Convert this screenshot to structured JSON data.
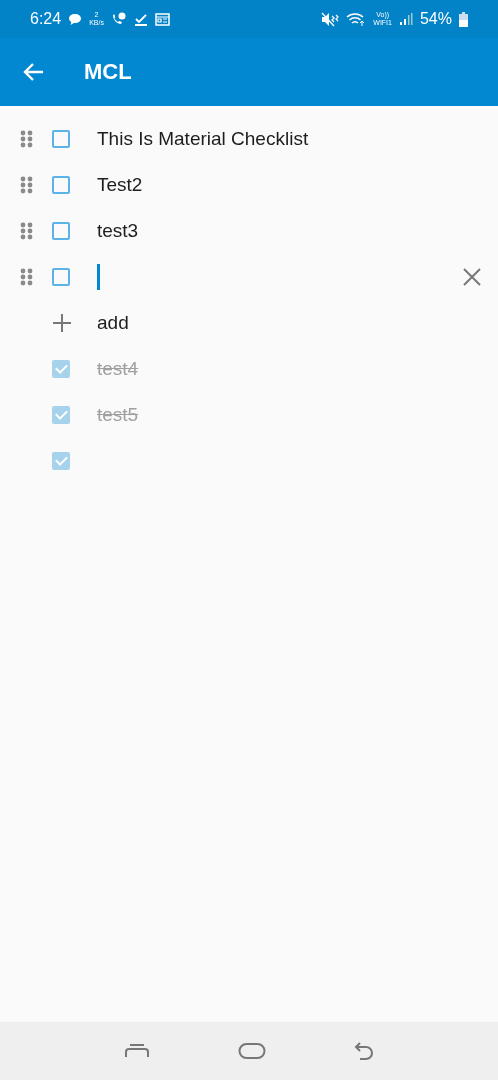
{
  "status_bar": {
    "time": "6:24",
    "net_speed": "2",
    "net_unit": "KB/s",
    "volte": "Vo))",
    "wifi_label": "WIFI1",
    "battery": "54%"
  },
  "app_bar": {
    "title": "MCL"
  },
  "items": [
    {
      "text": "This Is Material Checklist",
      "checked": false,
      "editing": false
    },
    {
      "text": "Test2",
      "checked": false,
      "editing": false
    },
    {
      "text": "test3",
      "checked": false,
      "editing": false
    },
    {
      "checked": false,
      "editing": true
    },
    {
      "kind": "add",
      "text": "add"
    },
    {
      "text": "test4",
      "checked": true,
      "editing": false
    },
    {
      "text": "test5",
      "checked": true,
      "editing": false
    },
    {
      "checked": true,
      "editing": false
    }
  ]
}
